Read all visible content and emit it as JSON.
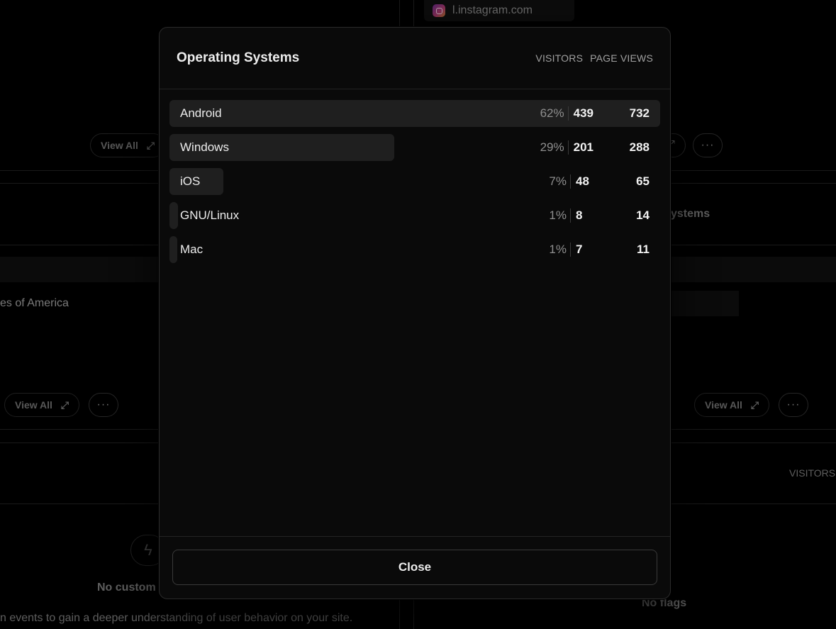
{
  "background": {
    "referrer_item": "l.instagram.com",
    "view_all_label": "View All",
    "more_label": "···",
    "country_fragment": "es of America",
    "systems_fragment": "ystems",
    "visitors_fragment": "VISITORS",
    "no_custom_fragment": "No custom",
    "no_flags_label": "No flags",
    "events_fragment": "n events to gain a deeper understanding of user behavior on your site."
  },
  "modal": {
    "title": "Operating Systems",
    "col_visitors": "VISITORS",
    "col_page_views": "PAGE VIEWS",
    "rows": [
      {
        "label": "Android",
        "percent": "62%",
        "visitors": "439",
        "page_views": "732",
        "share": 1.0
      },
      {
        "label": "Windows",
        "percent": "29%",
        "visitors": "201",
        "page_views": "288",
        "share": 0.458
      },
      {
        "label": "iOS",
        "percent": "7%",
        "visitors": "48",
        "page_views": "65",
        "share": 0.11
      },
      {
        "label": "GNU/Linux",
        "percent": "1%",
        "visitors": "8",
        "page_views": "14",
        "share": 0.018
      },
      {
        "label": "Mac",
        "percent": "1%",
        "visitors": "7",
        "page_views": "11",
        "share": 0.016
      }
    ],
    "close_label": "Close"
  }
}
